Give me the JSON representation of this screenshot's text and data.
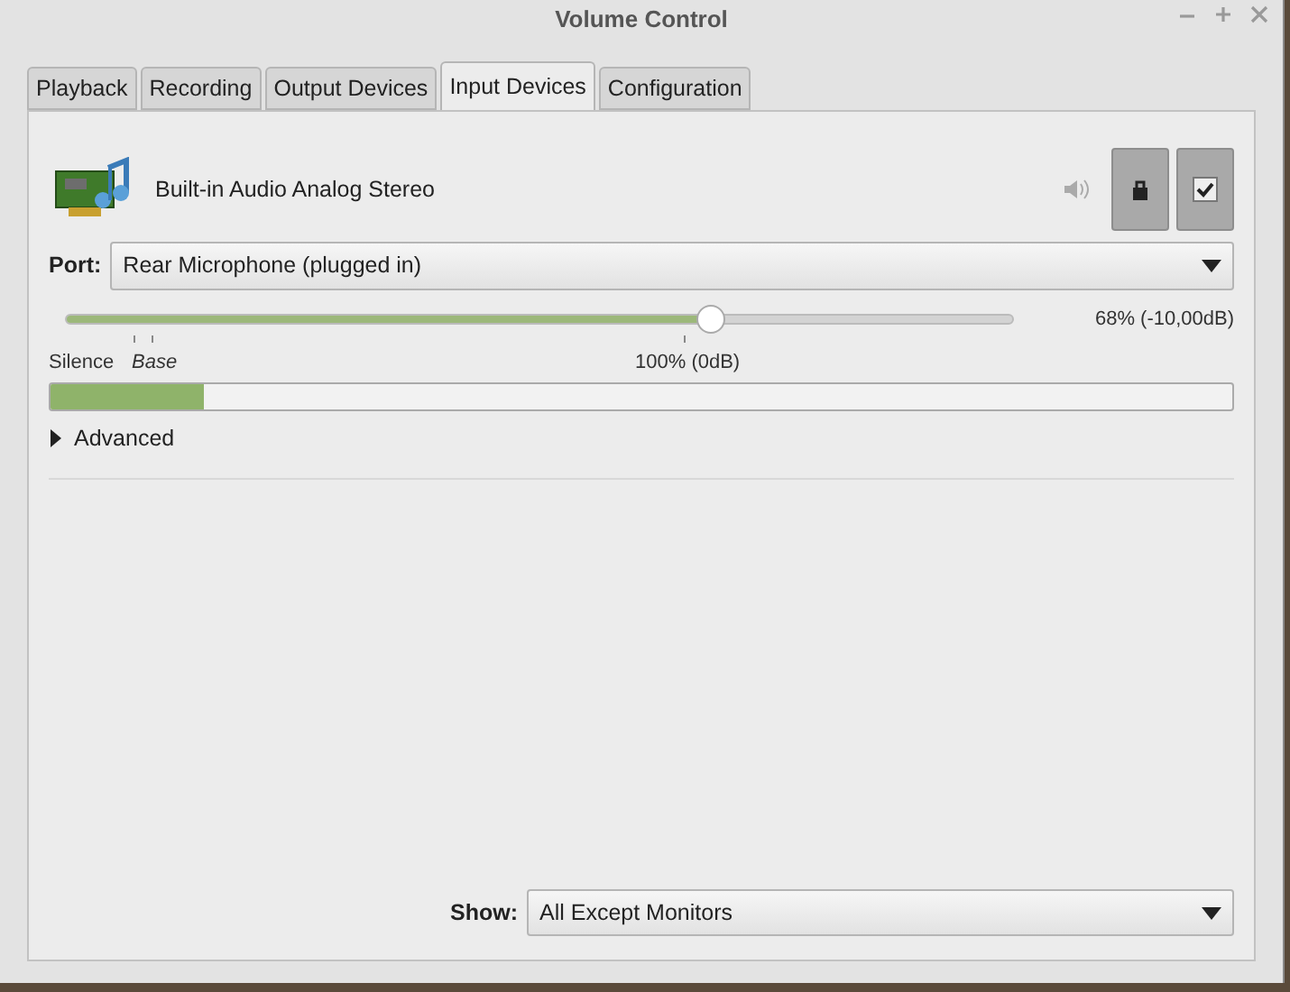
{
  "window": {
    "title": "Volume Control"
  },
  "tabs": [
    {
      "label": "Playback",
      "selected": false
    },
    {
      "label": "Recording",
      "selected": false
    },
    {
      "label": "Output Devices",
      "selected": false
    },
    {
      "label": "Input Devices",
      "selected": true
    },
    {
      "label": "Configuration",
      "selected": false
    }
  ],
  "device": {
    "name": "Built-in Audio Analog Stereo",
    "lock_pressed": true,
    "default_pressed": true,
    "port_label": "Port:",
    "port": "Rear Microphone (plugged in)",
    "volume": {
      "level": 0.68,
      "reading": "68% (-10,00dB)",
      "silence_label": "Silence",
      "base_label": "Base",
      "hundred_label": "100% (0dB)"
    },
    "peak": {
      "level": 0.13
    },
    "advanced": {
      "label": "Advanced",
      "expanded": false
    }
  },
  "show": {
    "label": "Show:",
    "value": "All Except Monitors"
  }
}
